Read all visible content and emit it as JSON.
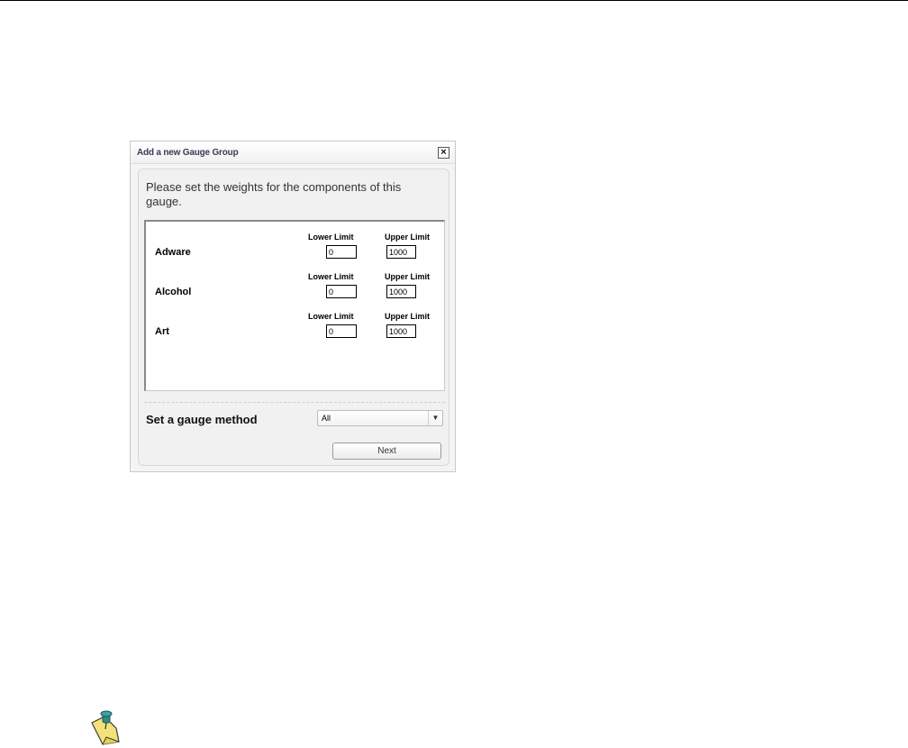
{
  "dialog": {
    "title": "Add a new Gauge Group",
    "close_label": "×",
    "intro": "Please set the weights for the components of this gauge.",
    "columns": {
      "lower": "Lower Limit",
      "upper": "Upper Limit"
    },
    "components": [
      {
        "name": "Adware",
        "lower": "0",
        "upper": "1000"
      },
      {
        "name": "Alcohol",
        "lower": "0",
        "upper": "1000"
      },
      {
        "name": "Art",
        "lower": "0",
        "upper": "1000"
      }
    ],
    "method_label": "Set a gauge method",
    "method_value": "All",
    "next_label": "Next"
  },
  "icons": {
    "close": "close-icon",
    "dropdown": "chevron-down-icon",
    "note": "note-pushpin-icon"
  },
  "colors": {
    "title": "#3a3a56",
    "note_paper": "#f3e27a",
    "pin": "#2c8a88"
  }
}
